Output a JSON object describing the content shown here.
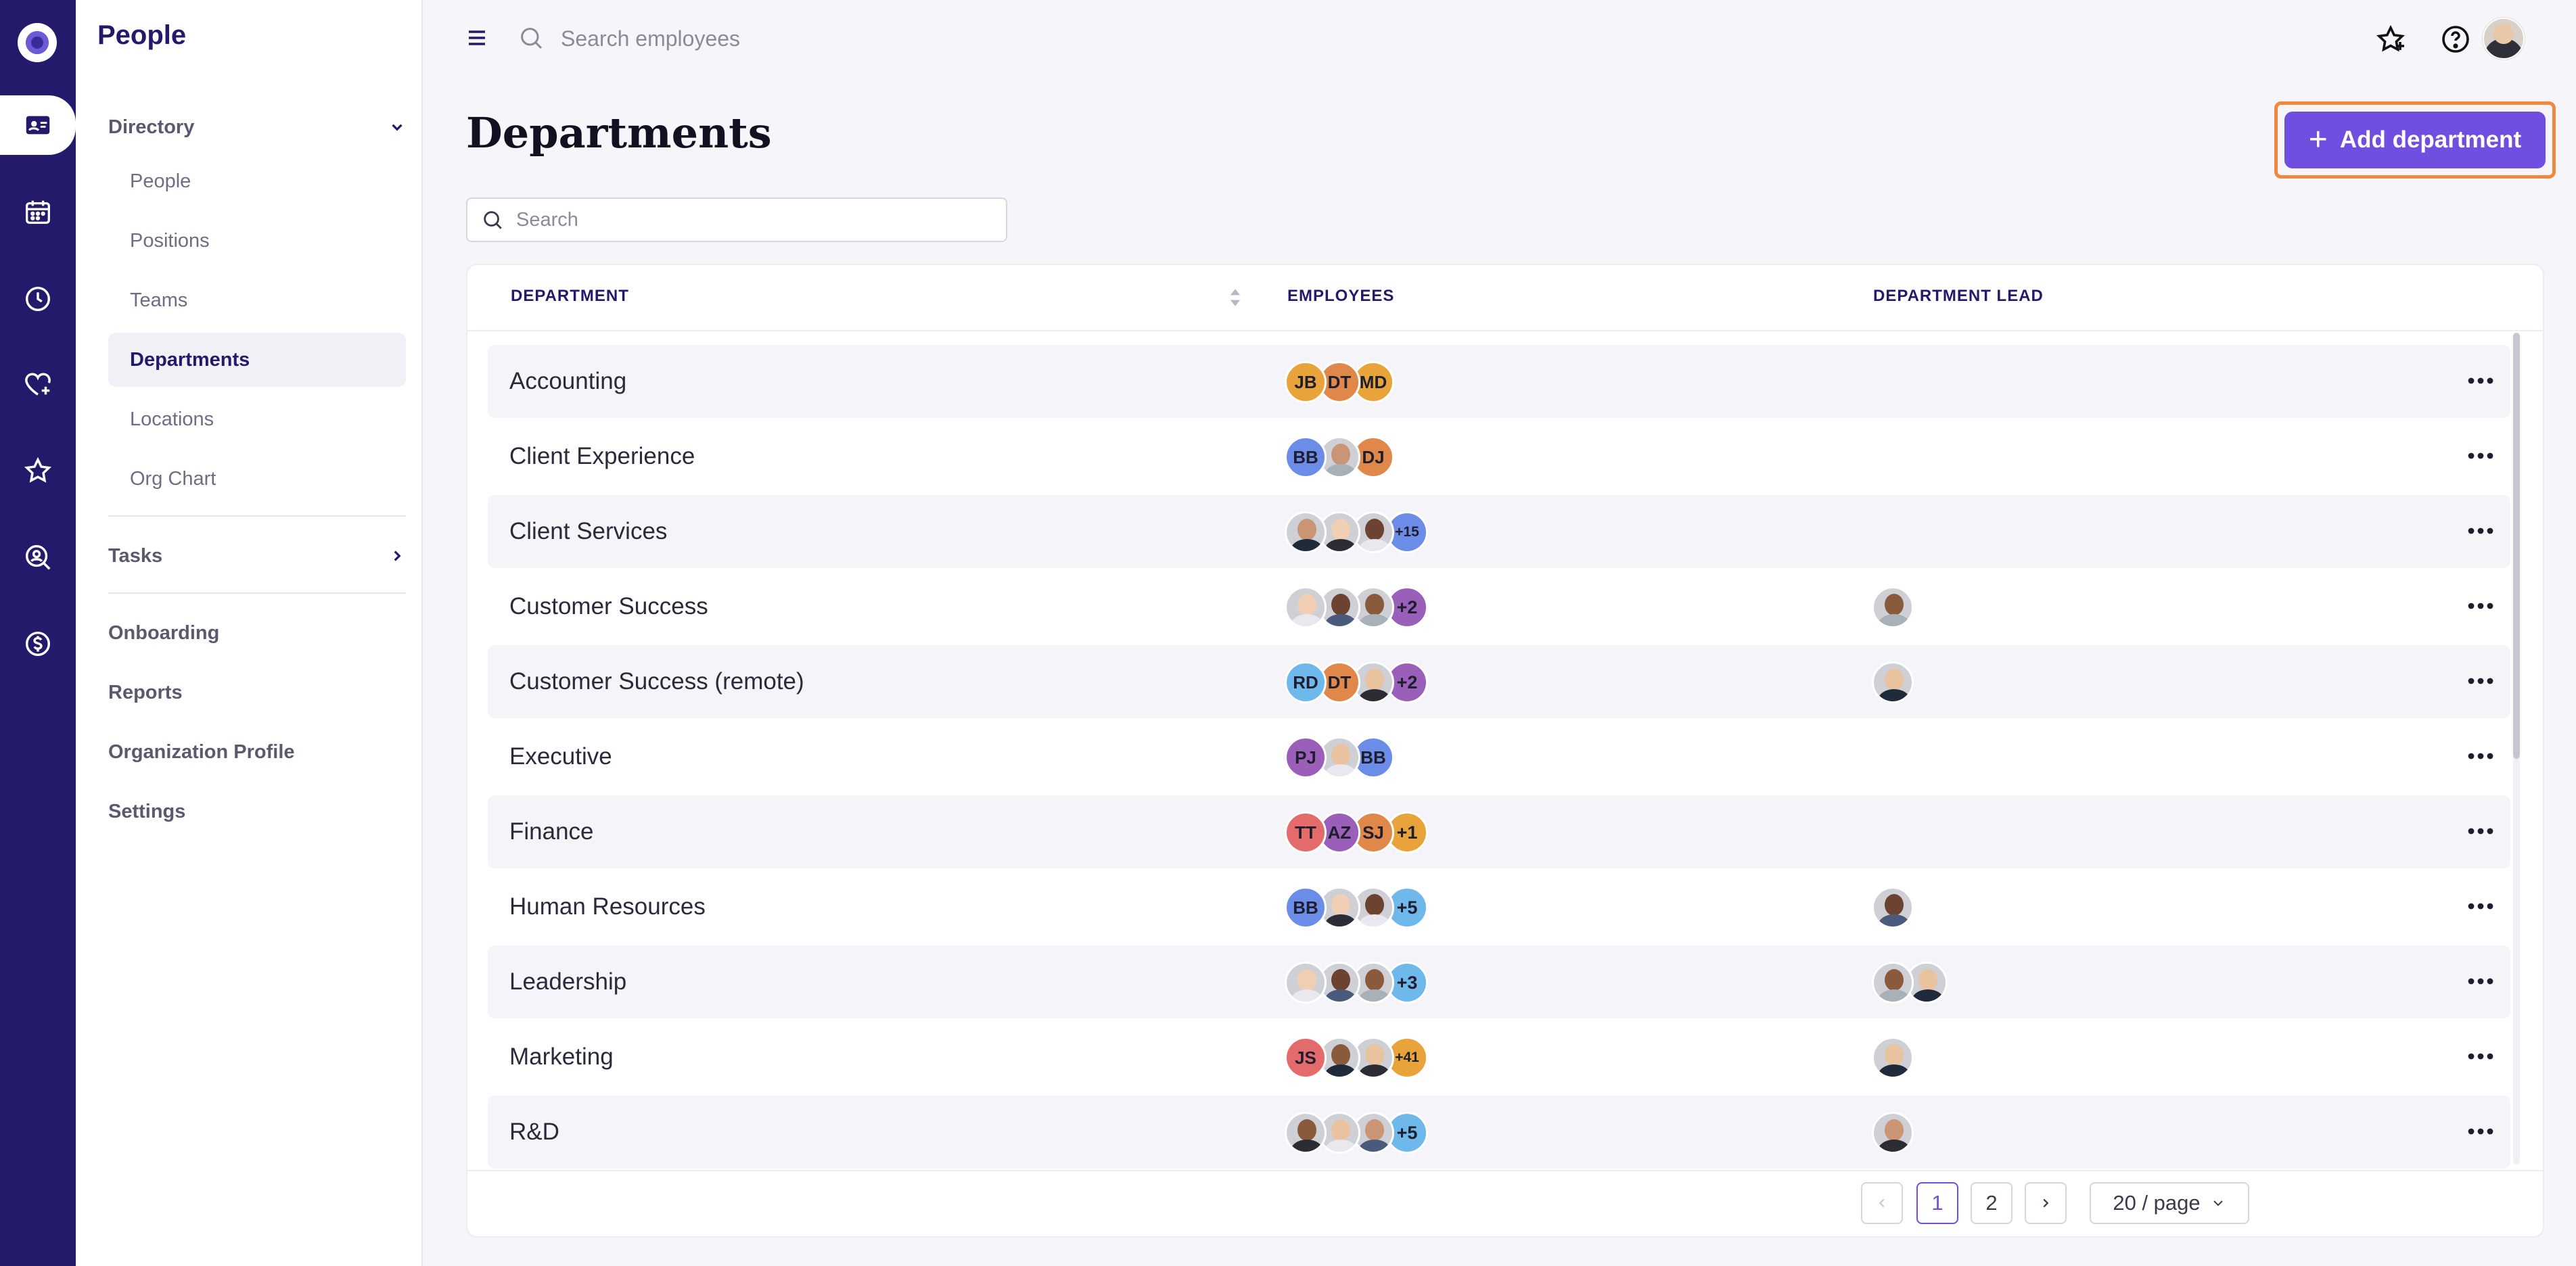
{
  "app": {
    "brand": "People"
  },
  "sidebar": {
    "directory_label": "Directory",
    "directory_items": [
      {
        "label": "People"
      },
      {
        "label": "Positions"
      },
      {
        "label": "Teams"
      },
      {
        "label": "Departments",
        "active": true
      },
      {
        "label": "Locations"
      },
      {
        "label": "Org Chart"
      }
    ],
    "tasks_label": "Tasks",
    "other_items": [
      {
        "label": "Onboarding"
      },
      {
        "label": "Reports"
      },
      {
        "label": "Organization Profile"
      },
      {
        "label": "Settings"
      }
    ]
  },
  "topbar": {
    "search_placeholder": "Search employees"
  },
  "page": {
    "title": "Departments",
    "add_button": "Add department",
    "search_placeholder": "Search"
  },
  "table": {
    "columns": [
      "DEPARTMENT",
      "EMPLOYEES",
      "DEPARTMENT LEAD"
    ],
    "rows": [
      {
        "name": "Accounting",
        "employees": [
          {
            "t": "JB",
            "c": "#e8a33a"
          },
          {
            "t": "DT",
            "c": "#e0874a"
          },
          {
            "t": "MD",
            "c": "#e8a33a",
            "small": true
          }
        ],
        "leads": 0
      },
      {
        "name": "Client Experience",
        "employees": [
          {
            "t": "BB",
            "c": "#6b8de8"
          },
          {
            "photo": true
          },
          {
            "t": "DJ",
            "c": "#e0874a"
          }
        ],
        "leads": 0
      },
      {
        "name": "Client Services",
        "employees": [
          {
            "photo": true
          },
          {
            "photo": true
          },
          {
            "photo": true
          },
          {
            "t": "+15",
            "c": "#6b8de8",
            "small": true
          }
        ],
        "leads": 0
      },
      {
        "name": "Customer Success",
        "employees": [
          {
            "photo": true
          },
          {
            "photo": true
          },
          {
            "photo": true
          },
          {
            "t": "+2",
            "c": "#9a5fb8"
          }
        ],
        "leads": 1
      },
      {
        "name": "Customer Success (remote)",
        "employees": [
          {
            "t": "RD",
            "c": "#6fb8ec"
          },
          {
            "t": "DT",
            "c": "#e0874a"
          },
          {
            "photo": true
          },
          {
            "t": "+2",
            "c": "#9a5fb8"
          }
        ],
        "leads": 1
      },
      {
        "name": "Executive",
        "employees": [
          {
            "t": "PJ",
            "c": "#9a5fb8"
          },
          {
            "photo": true
          },
          {
            "t": "BB",
            "c": "#6b8de8"
          }
        ],
        "leads": 0
      },
      {
        "name": "Finance",
        "employees": [
          {
            "t": "TT",
            "c": "#e46b6b"
          },
          {
            "t": "AZ",
            "c": "#9a5fb8"
          },
          {
            "t": "SJ",
            "c": "#e0874a"
          },
          {
            "t": "+1",
            "c": "#e8a33a"
          }
        ],
        "leads": 0
      },
      {
        "name": "Human Resources",
        "employees": [
          {
            "t": "BB",
            "c": "#6b8de8"
          },
          {
            "photo": true
          },
          {
            "photo": true
          },
          {
            "t": "+5",
            "c": "#6fb8ec"
          }
        ],
        "leads": 1
      },
      {
        "name": "Leadership",
        "employees": [
          {
            "photo": true
          },
          {
            "photo": true
          },
          {
            "photo": true
          },
          {
            "t": "+3",
            "c": "#6fb8ec"
          }
        ],
        "leads": 2
      },
      {
        "name": "Marketing",
        "employees": [
          {
            "t": "JS",
            "c": "#e46b6b"
          },
          {
            "photo": true
          },
          {
            "photo": true
          },
          {
            "t": "+41",
            "c": "#e8a33a",
            "small": true
          }
        ],
        "leads": 1
      },
      {
        "name": "R&D",
        "employees": [
          {
            "photo": true
          },
          {
            "photo": true
          },
          {
            "photo": true
          },
          {
            "t": "+5",
            "c": "#6fb8ec"
          }
        ],
        "leads": 1
      }
    ]
  },
  "pagination": {
    "pages": [
      "1",
      "2"
    ],
    "current": "1",
    "page_size": "20 / page"
  }
}
